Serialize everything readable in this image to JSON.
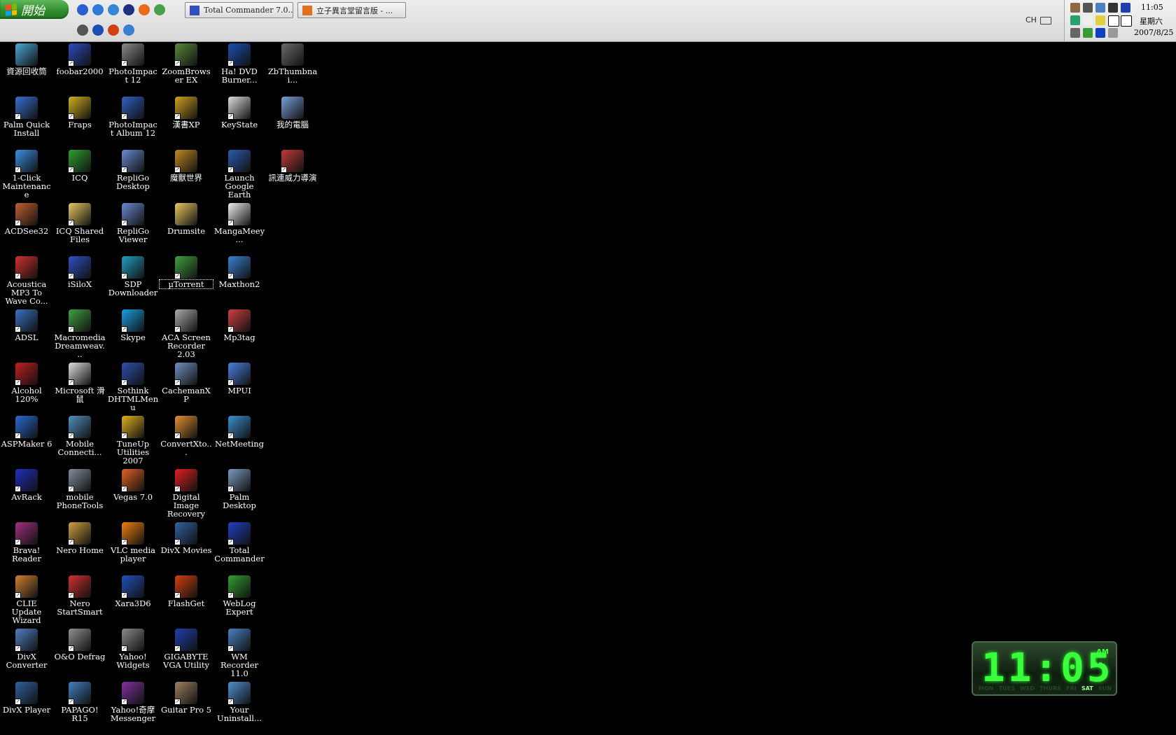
{
  "taskbar": {
    "start_label": "開始",
    "tasks": [
      {
        "label": "Total Commander 7.0...",
        "icon": "total-commander-icon",
        "color": "#3050c0"
      },
      {
        "label": "立子異言堂留言版 - ...",
        "icon": "firefox-icon",
        "color": "#e07020"
      }
    ],
    "quick_launch": [
      {
        "icon": "media-player-icon",
        "color": "#2a5fd0"
      },
      {
        "icon": "ie-icon",
        "color": "#2f7ad8"
      },
      {
        "icon": "outlook-icon",
        "color": "#3a84d8"
      },
      {
        "icon": "save-icon",
        "color": "#203080"
      },
      {
        "icon": "firefox-icon",
        "color": "#e86a1c"
      },
      {
        "icon": "network-icon",
        "color": "#4aa04a"
      },
      {
        "icon": "spy-icon",
        "color": "#555555"
      },
      {
        "icon": "ha-icon",
        "color": "#1a4fb0"
      },
      {
        "icon": "flashget-icon",
        "color": "#d04010"
      },
      {
        "icon": "maxthon-icon",
        "color": "#3a80d0"
      }
    ],
    "language": "CH",
    "clock": {
      "time": "11:05",
      "day": "星期六",
      "date": "2007/8/25"
    }
  },
  "desktop": {
    "icons": [
      {
        "label": "資源回收筒",
        "icon": "recycle-bin-icon",
        "color": "#4aa8d8",
        "col": 0,
        "row": 0,
        "shortcut": false
      },
      {
        "label": "foobar2000",
        "icon": "foobar-icon",
        "color": "#2d4bbd",
        "col": 1,
        "row": 0,
        "shortcut": true
      },
      {
        "label": "PhotoImpact 12",
        "icon": "photoimpact-icon",
        "color": "#8a8a8a",
        "col": 2,
        "row": 0,
        "shortcut": true
      },
      {
        "label": "ZoomBrowser EX",
        "icon": "zoombrowser-icon",
        "color": "#5a8a3a",
        "col": 3,
        "row": 0,
        "shortcut": true
      },
      {
        "label": "Ha! DVD Burner...",
        "icon": "ha-dvd-icon",
        "color": "#1a4fb0",
        "col": 4,
        "row": 0,
        "shortcut": true
      },
      {
        "label": "ZbThumbnai...",
        "icon": "thumbnail-file-icon",
        "color": "#6a6a6a",
        "col": 5,
        "row": 0,
        "shortcut": false
      },
      {
        "label": "Palm Quick Install",
        "icon": "palm-install-icon",
        "color": "#3a6fd0",
        "col": 0,
        "row": 1,
        "shortcut": true
      },
      {
        "label": "Fraps",
        "icon": "fraps-icon",
        "color": "#d0b020",
        "col": 1,
        "row": 1,
        "shortcut": true
      },
      {
        "label": "PhotoImpact Album 12",
        "icon": "photo-album-icon",
        "color": "#3060c0",
        "col": 2,
        "row": 1,
        "shortcut": true
      },
      {
        "label": "漢書XP",
        "icon": "hanshu-icon",
        "color": "#d0a020",
        "col": 3,
        "row": 1,
        "shortcut": true
      },
      {
        "label": "KeyState",
        "icon": "keystate-icon",
        "color": "#dddddd",
        "col": 4,
        "row": 1,
        "shortcut": true
      },
      {
        "label": "我的電腦",
        "icon": "my-computer-icon",
        "color": "#7aa0d8",
        "col": 5,
        "row": 1,
        "shortcut": false
      },
      {
        "label": "1-Click Maintenance",
        "icon": "maintenance-icon",
        "color": "#3a90e0",
        "col": 0,
        "row": 2,
        "shortcut": true
      },
      {
        "label": "ICQ",
        "icon": "icq-icon",
        "color": "#2fa02f",
        "col": 1,
        "row": 2,
        "shortcut": true
      },
      {
        "label": "RepliGo Desktop",
        "icon": "repligo-desktop-icon",
        "color": "#6a8ad0",
        "col": 2,
        "row": 2,
        "shortcut": true
      },
      {
        "label": "魔獸世界",
        "icon": "warcraft-icon",
        "color": "#c08a20",
        "col": 3,
        "row": 2,
        "shortcut": true
      },
      {
        "label": "Launch Google Earth",
        "icon": "google-earth-icon",
        "color": "#2a5ab0",
        "col": 4,
        "row": 2,
        "shortcut": true
      },
      {
        "label": "訊連威力導演",
        "icon": "powerdirector-icon",
        "color": "#c03a3a",
        "col": 5,
        "row": 2,
        "shortcut": true
      },
      {
        "label": "ACDSee32",
        "icon": "acdsee-icon",
        "color": "#c06030",
        "col": 0,
        "row": 3,
        "shortcut": true
      },
      {
        "label": "ICQ Shared Files",
        "icon": "folder-icq-icon",
        "color": "#e8c860",
        "col": 1,
        "row": 3,
        "shortcut": true
      },
      {
        "label": "RepliGo Viewer",
        "icon": "repligo-viewer-icon",
        "color": "#6a8ad0",
        "col": 2,
        "row": 3,
        "shortcut": true
      },
      {
        "label": "Drumsite",
        "icon": "folder-icon",
        "color": "#e8c860",
        "col": 3,
        "row": 3,
        "shortcut": false
      },
      {
        "label": "MangaMeey...",
        "icon": "manga-icon",
        "color": "#eeeeee",
        "col": 4,
        "row": 3,
        "shortcut": true
      },
      {
        "label": "Acoustica MP3 To Wave Co...",
        "icon": "acoustica-icon",
        "color": "#d03030",
        "col": 0,
        "row": 4,
        "shortcut": true
      },
      {
        "label": "iSiloX",
        "icon": "isilox-icon",
        "color": "#3050c0",
        "col": 1,
        "row": 4,
        "shortcut": true
      },
      {
        "label": "SDP Downloader",
        "icon": "sdp-icon",
        "color": "#20a0c0",
        "col": 2,
        "row": 4,
        "shortcut": true
      },
      {
        "label": "µTorrent",
        "icon": "utorrent-icon",
        "color": "#40a040",
        "col": 3,
        "row": 4,
        "shortcut": true,
        "selected": true
      },
      {
        "label": "Maxthon2",
        "icon": "maxthon-icon",
        "color": "#3a80d0",
        "col": 4,
        "row": 4,
        "shortcut": true
      },
      {
        "label": "ADSL",
        "icon": "adsl-icon",
        "color": "#3a70c0",
        "col": 0,
        "row": 5,
        "shortcut": true
      },
      {
        "label": "Macromedia Dreamweav...",
        "icon": "dreamweaver-icon",
        "color": "#40a040",
        "col": 1,
        "row": 5,
        "shortcut": true
      },
      {
        "label": "Skype",
        "icon": "skype-icon",
        "color": "#1a9ee0",
        "col": 2,
        "row": 5,
        "shortcut": true
      },
      {
        "label": "ACA Screen Recorder 2.03",
        "icon": "screen-recorder-icon",
        "color": "#aaaaaa",
        "col": 3,
        "row": 5,
        "shortcut": true
      },
      {
        "label": "Mp3tag",
        "icon": "mp3tag-icon",
        "color": "#d04040",
        "col": 4,
        "row": 5,
        "shortcut": true
      },
      {
        "label": "Alcohol 120%",
        "icon": "alcohol-icon",
        "color": "#c02020",
        "col": 0,
        "row": 6,
        "shortcut": true
      },
      {
        "label": "Microsoft 滑鼠",
        "icon": "mouse-pointer-icon",
        "color": "#dddddd",
        "col": 1,
        "row": 6,
        "shortcut": true
      },
      {
        "label": "Sothink DHTMLMenu",
        "icon": "sothink-icon",
        "color": "#3050b0",
        "col": 2,
        "row": 6,
        "shortcut": true
      },
      {
        "label": "CachemanXP",
        "icon": "cacheman-icon",
        "color": "#7090c0",
        "col": 3,
        "row": 6,
        "shortcut": true
      },
      {
        "label": "MPUI",
        "icon": "mpui-icon",
        "color": "#4a80e0",
        "col": 4,
        "row": 6,
        "shortcut": true
      },
      {
        "label": "ASPMaker 6",
        "icon": "aspmaker-icon",
        "color": "#2a6ad0",
        "col": 0,
        "row": 7,
        "shortcut": true
      },
      {
        "label": "Mobile Connecti...",
        "icon": "mobile-connection-icon",
        "color": "#5090c0",
        "col": 1,
        "row": 7,
        "shortcut": true
      },
      {
        "label": "TuneUp Utilities 2007",
        "icon": "tuneup-icon",
        "color": "#e0b020",
        "col": 2,
        "row": 7,
        "shortcut": true
      },
      {
        "label": "ConvertXto...",
        "icon": "convertx-icon",
        "color": "#e09030",
        "col": 3,
        "row": 7,
        "shortcut": true
      },
      {
        "label": "NetMeeting",
        "icon": "netmeeting-icon",
        "color": "#3a90d0",
        "col": 4,
        "row": 7,
        "shortcut": true
      },
      {
        "label": "AvRack",
        "icon": "avrack-icon",
        "color": "#2030c0",
        "col": 0,
        "row": 8,
        "shortcut": true
      },
      {
        "label": "mobile PhoneTools",
        "icon": "phonetools-icon",
        "color": "#8090a0",
        "col": 1,
        "row": 8,
        "shortcut": true
      },
      {
        "label": "Vegas 7.0",
        "icon": "vegas-icon",
        "color": "#e06020",
        "col": 2,
        "row": 8,
        "shortcut": true
      },
      {
        "label": "Digital Image Recovery",
        "icon": "image-recovery-icon",
        "color": "#e02020",
        "col": 3,
        "row": 8,
        "shortcut": true
      },
      {
        "label": "Palm Desktop",
        "icon": "palm-desktop-icon",
        "color": "#7a9ac0",
        "col": 4,
        "row": 8,
        "shortcut": true
      },
      {
        "label": "Brava! Reader",
        "icon": "brava-icon",
        "color": "#a03080",
        "col": 0,
        "row": 9,
        "shortcut": true
      },
      {
        "label": "Nero Home",
        "icon": "nero-home-icon",
        "color": "#d0a040",
        "col": 1,
        "row": 9,
        "shortcut": true
      },
      {
        "label": "VLC media player",
        "icon": "vlc-icon",
        "color": "#f08010",
        "col": 2,
        "row": 9,
        "shortcut": true
      },
      {
        "label": "DivX Movies",
        "icon": "divx-movies-icon",
        "color": "#3060a0",
        "col": 3,
        "row": 9,
        "shortcut": true
      },
      {
        "label": "Total Commander",
        "icon": "total-commander-icon",
        "color": "#2040c0",
        "col": 4,
        "row": 9,
        "shortcut": true
      },
      {
        "label": "CLIE Update Wizard",
        "icon": "clie-update-icon",
        "color": "#d08030",
        "col": 0,
        "row": 10,
        "shortcut": true
      },
      {
        "label": "Nero StartSmart",
        "icon": "nero-startsmart-icon",
        "color": "#d03030",
        "col": 1,
        "row": 10,
        "shortcut": true
      },
      {
        "label": "Xara3D6",
        "icon": "xara3d-icon",
        "color": "#2050c0",
        "col": 2,
        "row": 10,
        "shortcut": true
      },
      {
        "label": "FlashGet",
        "icon": "flashget-icon",
        "color": "#d04010",
        "col": 3,
        "row": 10,
        "shortcut": true
      },
      {
        "label": "WebLog Expert",
        "icon": "weblog-expert-icon",
        "color": "#30a030",
        "col": 4,
        "row": 10,
        "shortcut": true
      },
      {
        "label": "DivX Converter",
        "icon": "divx-converter-icon",
        "color": "#5080c0",
        "col": 0,
        "row": 11,
        "shortcut": true
      },
      {
        "label": "O&O Defrag",
        "icon": "defrag-icon",
        "color": "#909090",
        "col": 1,
        "row": 11,
        "shortcut": true
      },
      {
        "label": "Yahoo! Widgets",
        "icon": "yahoo-widgets-icon",
        "color": "#8a8a8a",
        "col": 2,
        "row": 11,
        "shortcut": true
      },
      {
        "label": "GIGABYTE VGA Utility",
        "icon": "gigabyte-icon",
        "color": "#2040b0",
        "col": 3,
        "row": 11,
        "shortcut": true
      },
      {
        "label": "WM Recorder 11.0",
        "icon": "wm-recorder-icon",
        "color": "#4a80c0",
        "col": 4,
        "row": 11,
        "shortcut": true
      },
      {
        "label": "DivX Player",
        "icon": "divx-player-icon",
        "color": "#3060a0",
        "col": 0,
        "row": 12,
        "shortcut": true
      },
      {
        "label": "PAPAGO! R15",
        "icon": "papago-icon",
        "color": "#4080c0",
        "col": 1,
        "row": 12,
        "shortcut": true
      },
      {
        "label": "Yahoo!奇摩 Messenger",
        "icon": "yahoo-messenger-icon",
        "color": "#8030a0",
        "col": 2,
        "row": 12,
        "shortcut": true
      },
      {
        "label": "Guitar Pro 5",
        "icon": "guitar-pro-icon",
        "color": "#a08060",
        "col": 3,
        "row": 12,
        "shortcut": true
      },
      {
        "label": "Your Uninstall...",
        "icon": "uninstall-icon",
        "color": "#5090d0",
        "col": 4,
        "row": 12,
        "shortcut": true
      }
    ]
  },
  "clock_widget": {
    "time": "11:05",
    "am": "AM",
    "pm": "PM",
    "days": [
      "MON",
      "TUES",
      "WED",
      "THURS",
      "FRI",
      "SAT",
      "SUN"
    ],
    "active_day": "SAT"
  }
}
